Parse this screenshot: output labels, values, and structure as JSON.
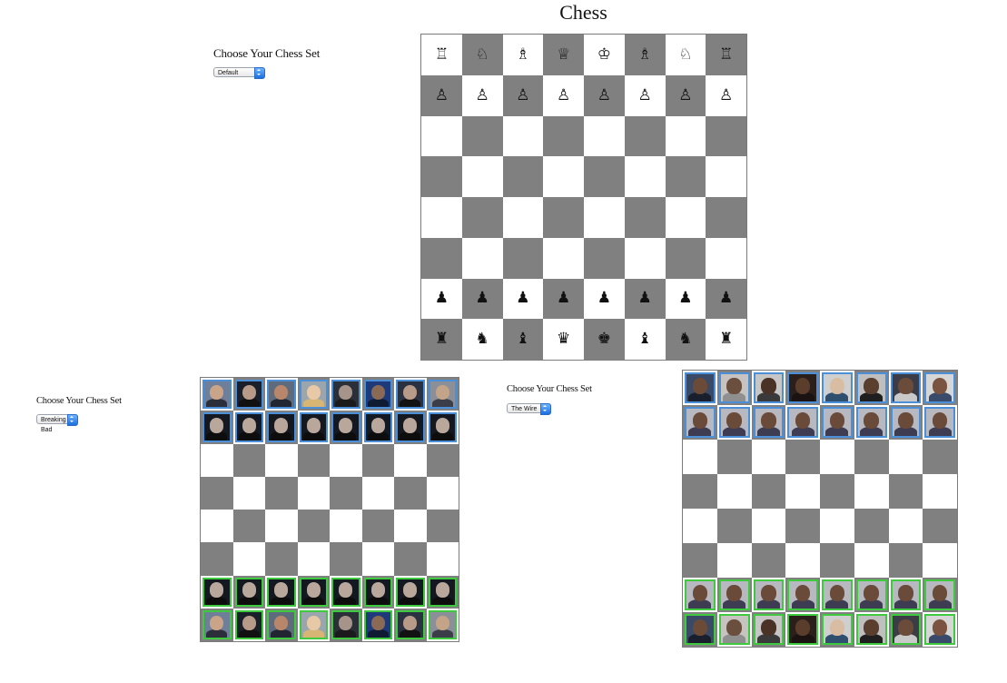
{
  "page_title": "Chess",
  "panels": [
    {
      "label": "Choose Your Chess Set",
      "selected": "Default"
    },
    {
      "label": "Choose Your Chess Set",
      "selected": "Breaking Bad"
    },
    {
      "label": "Choose Your Chess Set",
      "selected": "The Wire"
    }
  ],
  "default_set": {
    "rows": [
      [
        "♖",
        "♘",
        "♗",
        "♕",
        "♔",
        "♗",
        "♘",
        "♖"
      ],
      [
        "♙",
        "♙",
        "♙",
        "♙",
        "♙",
        "♙",
        "♙",
        "♙"
      ],
      [
        "",
        "",
        "",
        "",
        "",
        "",
        "",
        ""
      ],
      [
        "",
        "",
        "",
        "",
        "",
        "",
        "",
        ""
      ],
      [
        "",
        "",
        "",
        "",
        "",
        "",
        "",
        ""
      ],
      [
        "",
        "",
        "",
        "",
        "",
        "",
        "",
        ""
      ],
      [
        "♟",
        "♟",
        "♟",
        "♟",
        "♟",
        "♟",
        "♟",
        "♟"
      ],
      [
        "♜",
        "♞",
        "♝",
        "♛",
        "♚",
        "♝",
        "♞",
        "♜"
      ]
    ]
  },
  "photo_sets": {
    "breaking_bad": {
      "back_rank": [
        {
          "skin": "#c9a489",
          "bg": "#6f7f99",
          "cloth": "#2c2f3a"
        },
        {
          "skin": "#b89a88",
          "bg": "#1a1f2a",
          "cloth": "#111111"
        },
        {
          "skin": "#b8876b",
          "bg": "#5d6b7d",
          "cloth": "#222633"
        },
        {
          "skin": "#e7c9a8",
          "bg": "#9aa5ad",
          "cloth": "#d6b575"
        },
        {
          "skin": "#a6938a",
          "bg": "#2b2f38",
          "cloth": "#1b1b1b"
        },
        {
          "skin": "#8a6a55",
          "bg": "#1f3a7a",
          "cloth": "#0f1a33"
        },
        {
          "skin": "#b89a88",
          "bg": "#2a3140",
          "cloth": "#121212"
        },
        {
          "skin": "#c4a488",
          "bg": "#8a8f98",
          "cloth": "#3b3e48"
        }
      ],
      "pawn": {
        "skin": "#b9a79c",
        "bg": "#141820",
        "cloth": "#0d0d0d"
      },
      "top_border": "blue",
      "bottom_border": "green"
    },
    "the_wire": {
      "back_rank": [
        {
          "skin": "#6b4a37",
          "bg": "#3a4a66",
          "cloth": "#1a1f2e"
        },
        {
          "skin": "#6a4f3e",
          "bg": "#c7c3c0",
          "cloth": "#8f8f8f"
        },
        {
          "skin": "#4a3326",
          "bg": "#c6c6c6",
          "cloth": "#3a3a3a"
        },
        {
          "skin": "#5b3d2c",
          "bg": "#2a1f1a",
          "cloth": "#1a1311"
        },
        {
          "skin": "#d9bda2",
          "bg": "#cfcfcf",
          "cloth": "#2f4f6f"
        },
        {
          "skin": "#5a3f2f",
          "bg": "#bfbfbf",
          "cloth": "#1f1f1f"
        },
        {
          "skin": "#6b4b3a",
          "bg": "#3c3c46",
          "cloth": "#c9c9c9"
        },
        {
          "skin": "#7a5440",
          "bg": "#d6d6d6",
          "cloth": "#3a4a6a"
        }
      ],
      "pawn": {
        "skin": "#6a4a38",
        "bg": "#b8b8c0",
        "cloth": "#3d3c52"
      },
      "top_border": "blue",
      "bottom_border": "green"
    }
  }
}
